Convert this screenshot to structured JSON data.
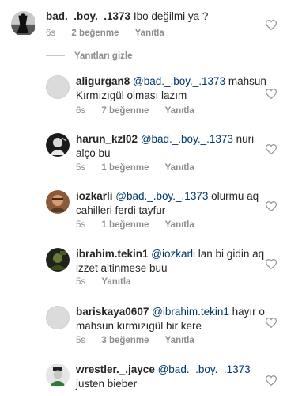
{
  "top_comment": {
    "username": "bad._.boy._.1373",
    "text": "Ibo değilmi ya ?",
    "time": "6s",
    "likes": "2 beğenme",
    "reply": "Yanıtla"
  },
  "hide_replies": "Yanıtları gizle",
  "replies": [
    {
      "username": "aligurgan8",
      "mention": "@bad._.boy._.1373",
      "text_line1": "mahsun",
      "text_line2": "Kırmızıgül olması lazım",
      "time": "6s",
      "likes": "7 beğenme",
      "reply": "Yanıtla"
    },
    {
      "username": "harun_kzl02",
      "mention": "@bad._.boy._.1373",
      "text_line1": "nuri",
      "text_line2": "alço bu",
      "time": "5s",
      "likes": "1 beğenme",
      "reply": "Yanıtla"
    },
    {
      "username": "iozkarli",
      "mention": "@bad._.boy._.1373",
      "text_line1": "olurmu aq",
      "text_line2": "cahilleri ferdi tayfur",
      "time": "5s",
      "likes": "1 beğenme",
      "reply": "Yanıtla"
    },
    {
      "username": "ibrahim.tekin1",
      "mention": "@iozkarli",
      "text_line1": "lan bi gidin aq",
      "text_line2": "izzet altinmese buu",
      "time": "5s",
      "reply": "Yanıtla"
    },
    {
      "username": "bariskaya0607",
      "mention": "@ibrahim.tekin1",
      "text_line1": "hayır o",
      "text_line2": "mahsun kırmızıgül bir kere",
      "time": "5s",
      "likes": "3 beğenme",
      "reply": "Yanıtla"
    },
    {
      "username": "wrestler._.jayce",
      "mention": "@bad._.boy._.1373",
      "text_line1": "",
      "text_line2": "justen bieber"
    }
  ],
  "colors": {
    "text": "#262626",
    "mention": "#00376b",
    "meta": "#8e8e8e",
    "heart_outline": "#8e8e8e"
  },
  "icons": [
    "heart-outline-icon",
    "avatar-placeholder-icon"
  ]
}
